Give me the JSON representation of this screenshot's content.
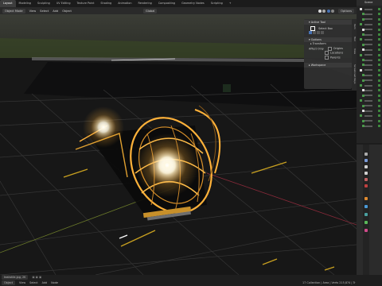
{
  "workspace_tabs": [
    {
      "label": "Layout",
      "active": true
    },
    {
      "label": "Modeling",
      "active": false
    },
    {
      "label": "Sculpting",
      "active": false
    },
    {
      "label": "UV Editing",
      "active": false
    },
    {
      "label": "Texture Paint",
      "active": false
    },
    {
      "label": "Shading",
      "active": false
    },
    {
      "label": "Animation",
      "active": false
    },
    {
      "label": "Rendering",
      "active": false
    },
    {
      "label": "Compositing",
      "active": false
    },
    {
      "label": "Geometry Nodes",
      "active": false
    },
    {
      "label": "Scripting",
      "active": false
    },
    {
      "label": "+",
      "active": false
    }
  ],
  "header": {
    "mode": "Object Mode",
    "menus": [
      "View",
      "Select",
      "Add",
      "Object"
    ],
    "transform_orientation": "Global",
    "options_label": "Options"
  },
  "npanel": {
    "tabs": [
      "Item",
      "Tool",
      "View",
      "Screencast Keys"
    ],
    "active_tool_title": "Active Tool",
    "active_tool_name": "Select Box",
    "options_title": "Options",
    "transform_label": "Transform",
    "affect_only_label": "Affect Only",
    "affect_only_items": [
      "Origins",
      "Locations",
      "Parents"
    ],
    "workspace_title": "Workspace"
  },
  "outliner": {
    "title": "Scene",
    "row_count": 24
  },
  "statusbar": {
    "file_name": "teakstile.jpg, 2K",
    "mode": "Object",
    "menus": [
      "View",
      "Select",
      "Add",
      "Node"
    ],
    "stats": "17 Collection | Area | Verts 215,874 | Tr",
    "select_hint": "Select",
    "frame": "0"
  },
  "colors": {
    "accent": "#4772b3",
    "active_tab": "#3d3d3d",
    "glow": "#ffb23a",
    "grid": "#3a3a3a"
  }
}
